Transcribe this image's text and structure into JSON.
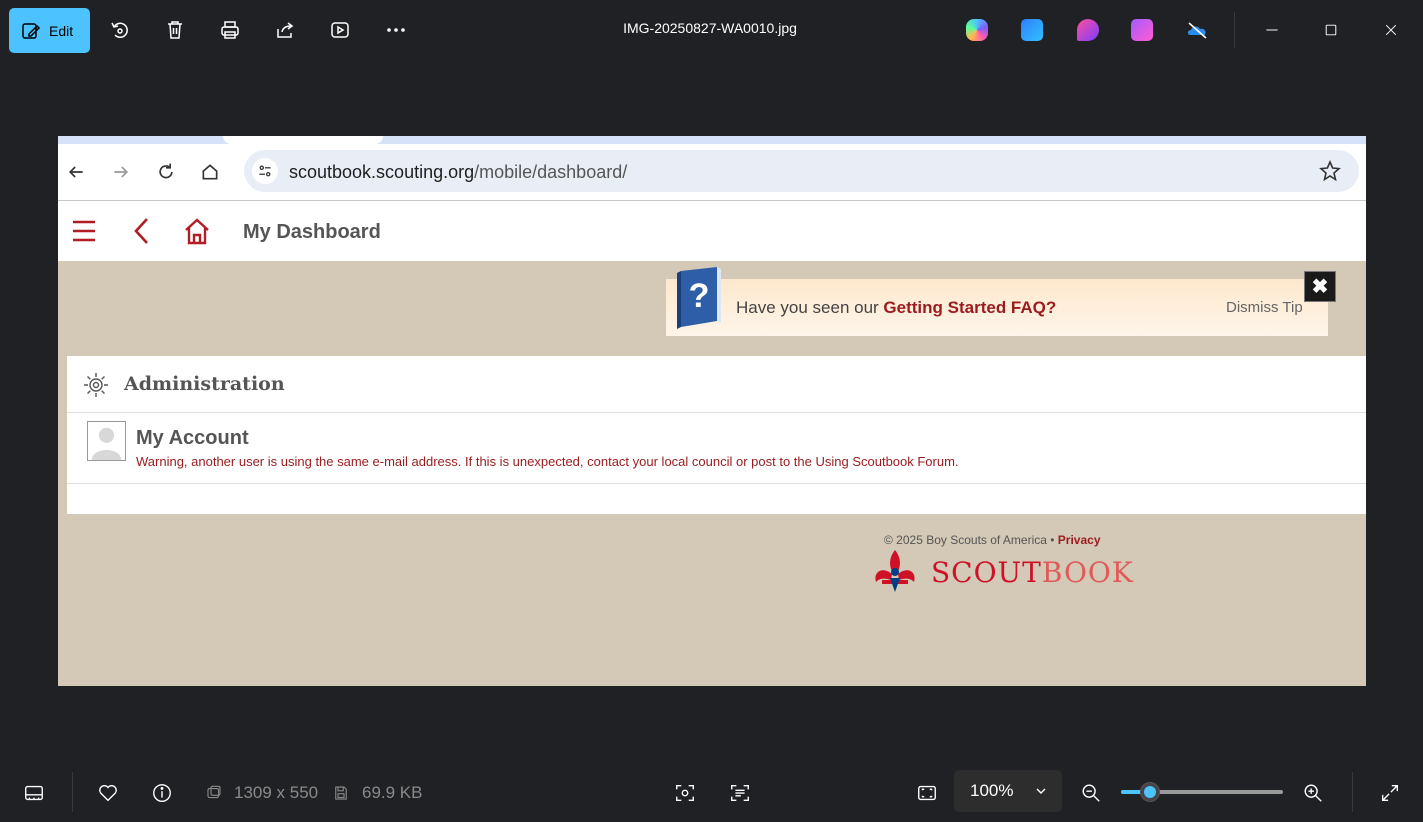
{
  "toolbar": {
    "edit_label": "Edit",
    "file_title": "IMG-20250827-WA0010.jpg",
    "icons": [
      "rotate-icon",
      "delete-icon",
      "print-icon",
      "share-icon",
      "slideshow-icon",
      "more-icon"
    ],
    "apps": [
      "copilot-icon",
      "photos-app-icon",
      "designer-icon",
      "clipchamp-icon",
      "onedrive-off-icon"
    ]
  },
  "browser": {
    "url_host": "scoutbook.scouting.org",
    "url_path": "/mobile/dashboard/"
  },
  "app": {
    "page_title": "My Dashboard",
    "tip": {
      "prefix": "Have you seen our ",
      "link": "Getting Started FAQ?",
      "dismiss": "Dismiss Tip",
      "close": "✖"
    },
    "admin": {
      "title": "Administration",
      "account_title": "My Account",
      "account_warning": "Warning, another user is using the same e-mail address. If this is unexpected, contact your local council or post to the Using Scoutbook Forum."
    },
    "footer": {
      "copyright": "© 2025 Boy Scouts of America • ",
      "privacy": "Privacy",
      "brand_scout": "SCOUT",
      "brand_book": "BOOK"
    }
  },
  "bottombar": {
    "dimensions": "1309 x 550",
    "file_size": "69.9 KB",
    "zoom": "100%",
    "zoom_slider_fraction": 0.18
  },
  "colors": {
    "accent": "#4cc2ff",
    "scout_red": "#ce1126",
    "page_tan": "#d3c9b6"
  }
}
